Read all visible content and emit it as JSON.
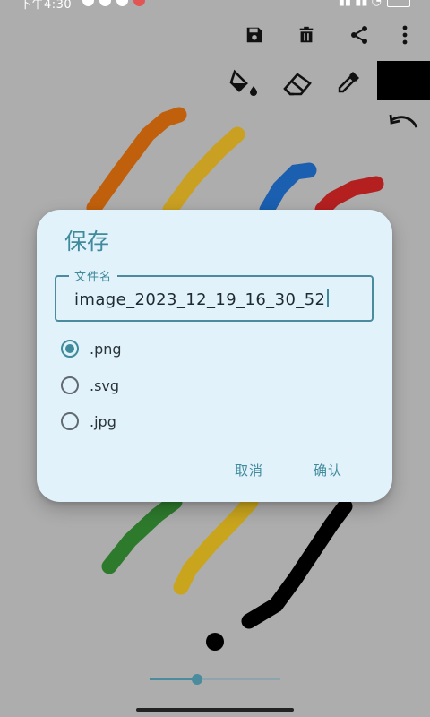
{
  "status_bar": {
    "time": "下午4:30"
  },
  "toolbar": {
    "icons": [
      "save-icon",
      "delete-icon",
      "share-icon",
      "more-icon",
      "fill-icon",
      "eraser-icon",
      "eyedropper-icon",
      "undo-icon"
    ],
    "current_color": "#000000"
  },
  "canvas": {
    "background": "#adadad",
    "stroke_colors": [
      "#c0600c",
      "#c9a022",
      "#1a5fb0",
      "#b42020",
      "#2d7a2d",
      "#c9b520",
      "#000000"
    ]
  },
  "dialog": {
    "title": "保存",
    "filename_label": "文件名",
    "filename_value": "image_2023_12_19_16_30_52",
    "formats": [
      ".png",
      ".svg",
      ".jpg"
    ],
    "selected_format": ".png",
    "cancel_label": "取消",
    "confirm_label": "确认"
  },
  "brush_size": {
    "value_fraction": 0.36
  },
  "accent_color": "#3f8a9b"
}
